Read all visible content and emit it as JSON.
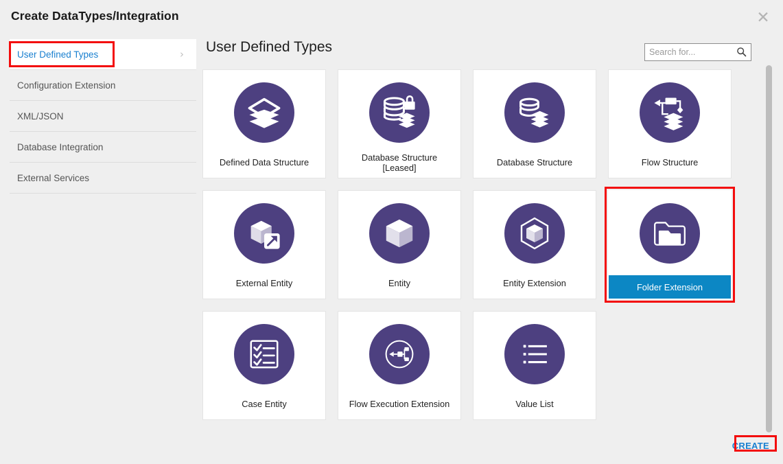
{
  "dialog": {
    "title": "Create DataTypes/Integration",
    "close_icon": "close-icon"
  },
  "sidebar": {
    "items": [
      {
        "label": "User Defined Types",
        "active": true,
        "chevron": "›"
      },
      {
        "label": "Configuration Extension",
        "active": false
      },
      {
        "label": "XML/JSON",
        "active": false
      },
      {
        "label": "Database Integration",
        "active": false
      },
      {
        "label": "External Services",
        "active": false
      }
    ]
  },
  "content": {
    "title": "User Defined Types",
    "search": {
      "placeholder": "Search for...",
      "value": "",
      "icon": "search-icon"
    }
  },
  "cards": [
    {
      "label": "Defined Data Structure",
      "icon": "layers-icon",
      "selected": false
    },
    {
      "label": "Database Structure [Leased]",
      "icon": "database-lock-icon",
      "selected": false
    },
    {
      "label": "Database Structure",
      "icon": "database-layers-icon",
      "selected": false
    },
    {
      "label": "Flow Structure",
      "icon": "flow-layers-icon",
      "selected": false
    },
    {
      "label": "External Entity",
      "icon": "cube-arrow-icon",
      "selected": false
    },
    {
      "label": "Entity",
      "icon": "cube-icon",
      "selected": false
    },
    {
      "label": "Entity Extension",
      "icon": "cube-hexagon-icon",
      "selected": false
    },
    {
      "label": "Folder Extension",
      "icon": "folder-icon",
      "selected": true
    },
    {
      "label": "Case Entity",
      "icon": "checklist-icon",
      "selected": false
    },
    {
      "label": "Flow Execution Extension",
      "icon": "flow-circle-icon",
      "selected": false
    },
    {
      "label": "Value List",
      "icon": "list-icon",
      "selected": false
    }
  ],
  "footer": {
    "create_label": "CREATE"
  },
  "colors": {
    "icon_purple": "#4d4080",
    "selected_blue": "#0c87c4",
    "highlight_red": "#f30c0c",
    "link_blue": "#1a80d0",
    "background": "#efefef"
  }
}
